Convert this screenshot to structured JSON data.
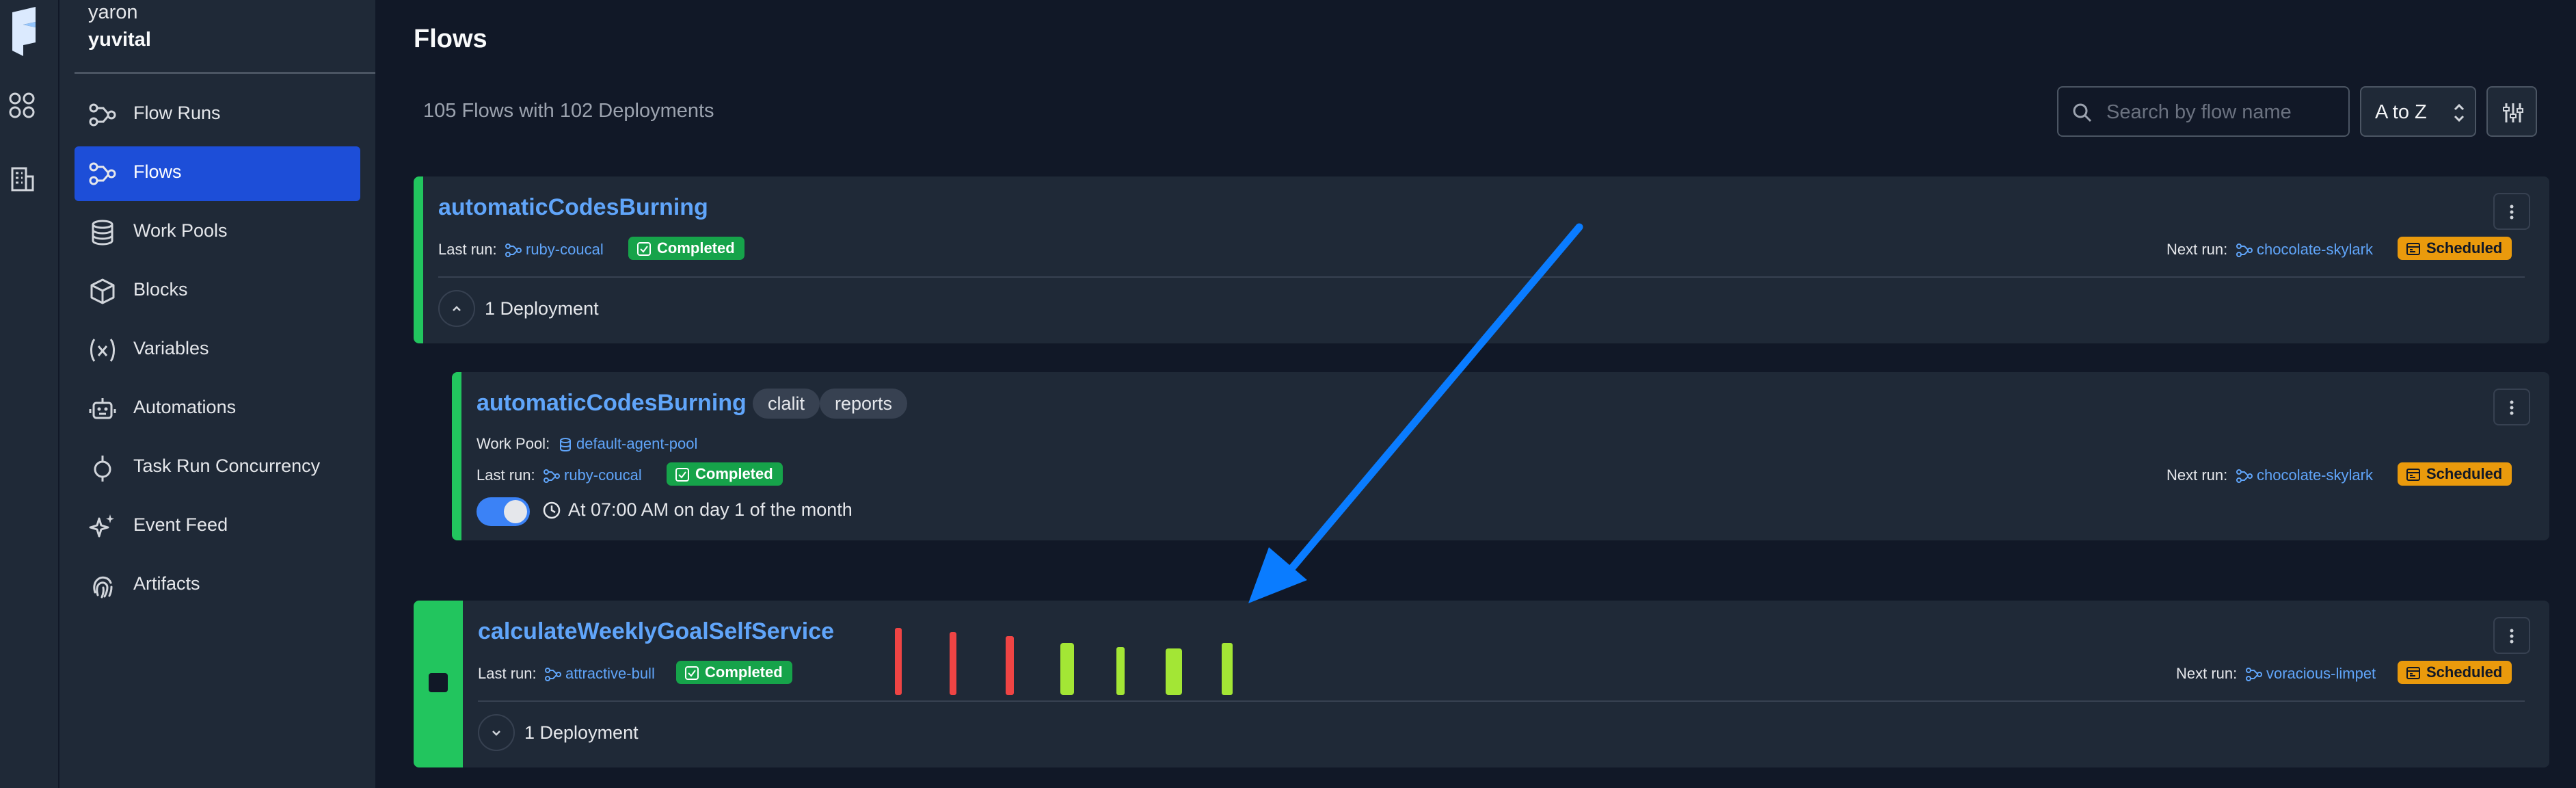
{
  "workspace": {
    "account": "yaron",
    "name": "yuvital"
  },
  "nav": [
    {
      "label": "Flow Runs",
      "icon": "flow-runs-icon",
      "active": false
    },
    {
      "label": "Flows",
      "icon": "flows-icon",
      "active": true
    },
    {
      "label": "Work Pools",
      "icon": "database-icon",
      "active": false
    },
    {
      "label": "Blocks",
      "icon": "cube-icon",
      "active": false
    },
    {
      "label": "Variables",
      "icon": "variable-icon",
      "active": false
    },
    {
      "label": "Automations",
      "icon": "robot-icon",
      "active": false
    },
    {
      "label": "Task Run Concurrency",
      "icon": "concurrency-icon",
      "active": false
    },
    {
      "label": "Event Feed",
      "icon": "sparkles-icon",
      "active": false
    },
    {
      "label": "Artifacts",
      "icon": "fingerprint-icon",
      "active": false
    }
  ],
  "page": {
    "title": "Flows",
    "count_text": "105 Flows with 102 Deployments",
    "search_placeholder": "Search by flow name",
    "sort_value": "A to Z"
  },
  "flows": [
    {
      "name": "automaticCodesBurning",
      "last_run_label": "Last run:",
      "last_run": "ruby-coucal",
      "last_state": "Completed",
      "next_run_label": "Next run:",
      "next_run": "chocolate-skylark",
      "next_state": "Scheduled",
      "deployments_label": "1 Deployment"
    },
    {
      "name": "calculateWeeklyGoalSelfService",
      "last_run_label": "Last run:",
      "last_run": "attractive-bull",
      "last_state": "Completed",
      "next_run_label": "Next run:",
      "next_run": "voracious-limpet",
      "next_state": "Scheduled",
      "deployments_label": "1 Deployment",
      "run_history": [
        "failed",
        "failed",
        "failed",
        "completed",
        "completed",
        "completed",
        "completed"
      ]
    }
  ],
  "deployment": {
    "name": "automaticCodesBurning",
    "tags": [
      "clalit",
      "reports"
    ],
    "work_pool_label": "Work Pool:",
    "work_pool": "default-agent-pool",
    "last_run_label": "Last run:",
    "last_run": "ruby-coucal",
    "last_state": "Completed",
    "next_run_label": "Next run:",
    "next_run": "chocolate-skylark",
    "next_state": "Scheduled",
    "schedule_enabled": true,
    "schedule_text": "At 07:00 AM on day 1 of the month"
  },
  "colors": {
    "accent": "#1d4ed8",
    "link": "#60a5fa",
    "completed": "#16a34a",
    "scheduled": "#ea9a0c",
    "failed": "#ef4444",
    "success_bar": "#a3e635",
    "annotation_arrow": "#0a7cff"
  }
}
